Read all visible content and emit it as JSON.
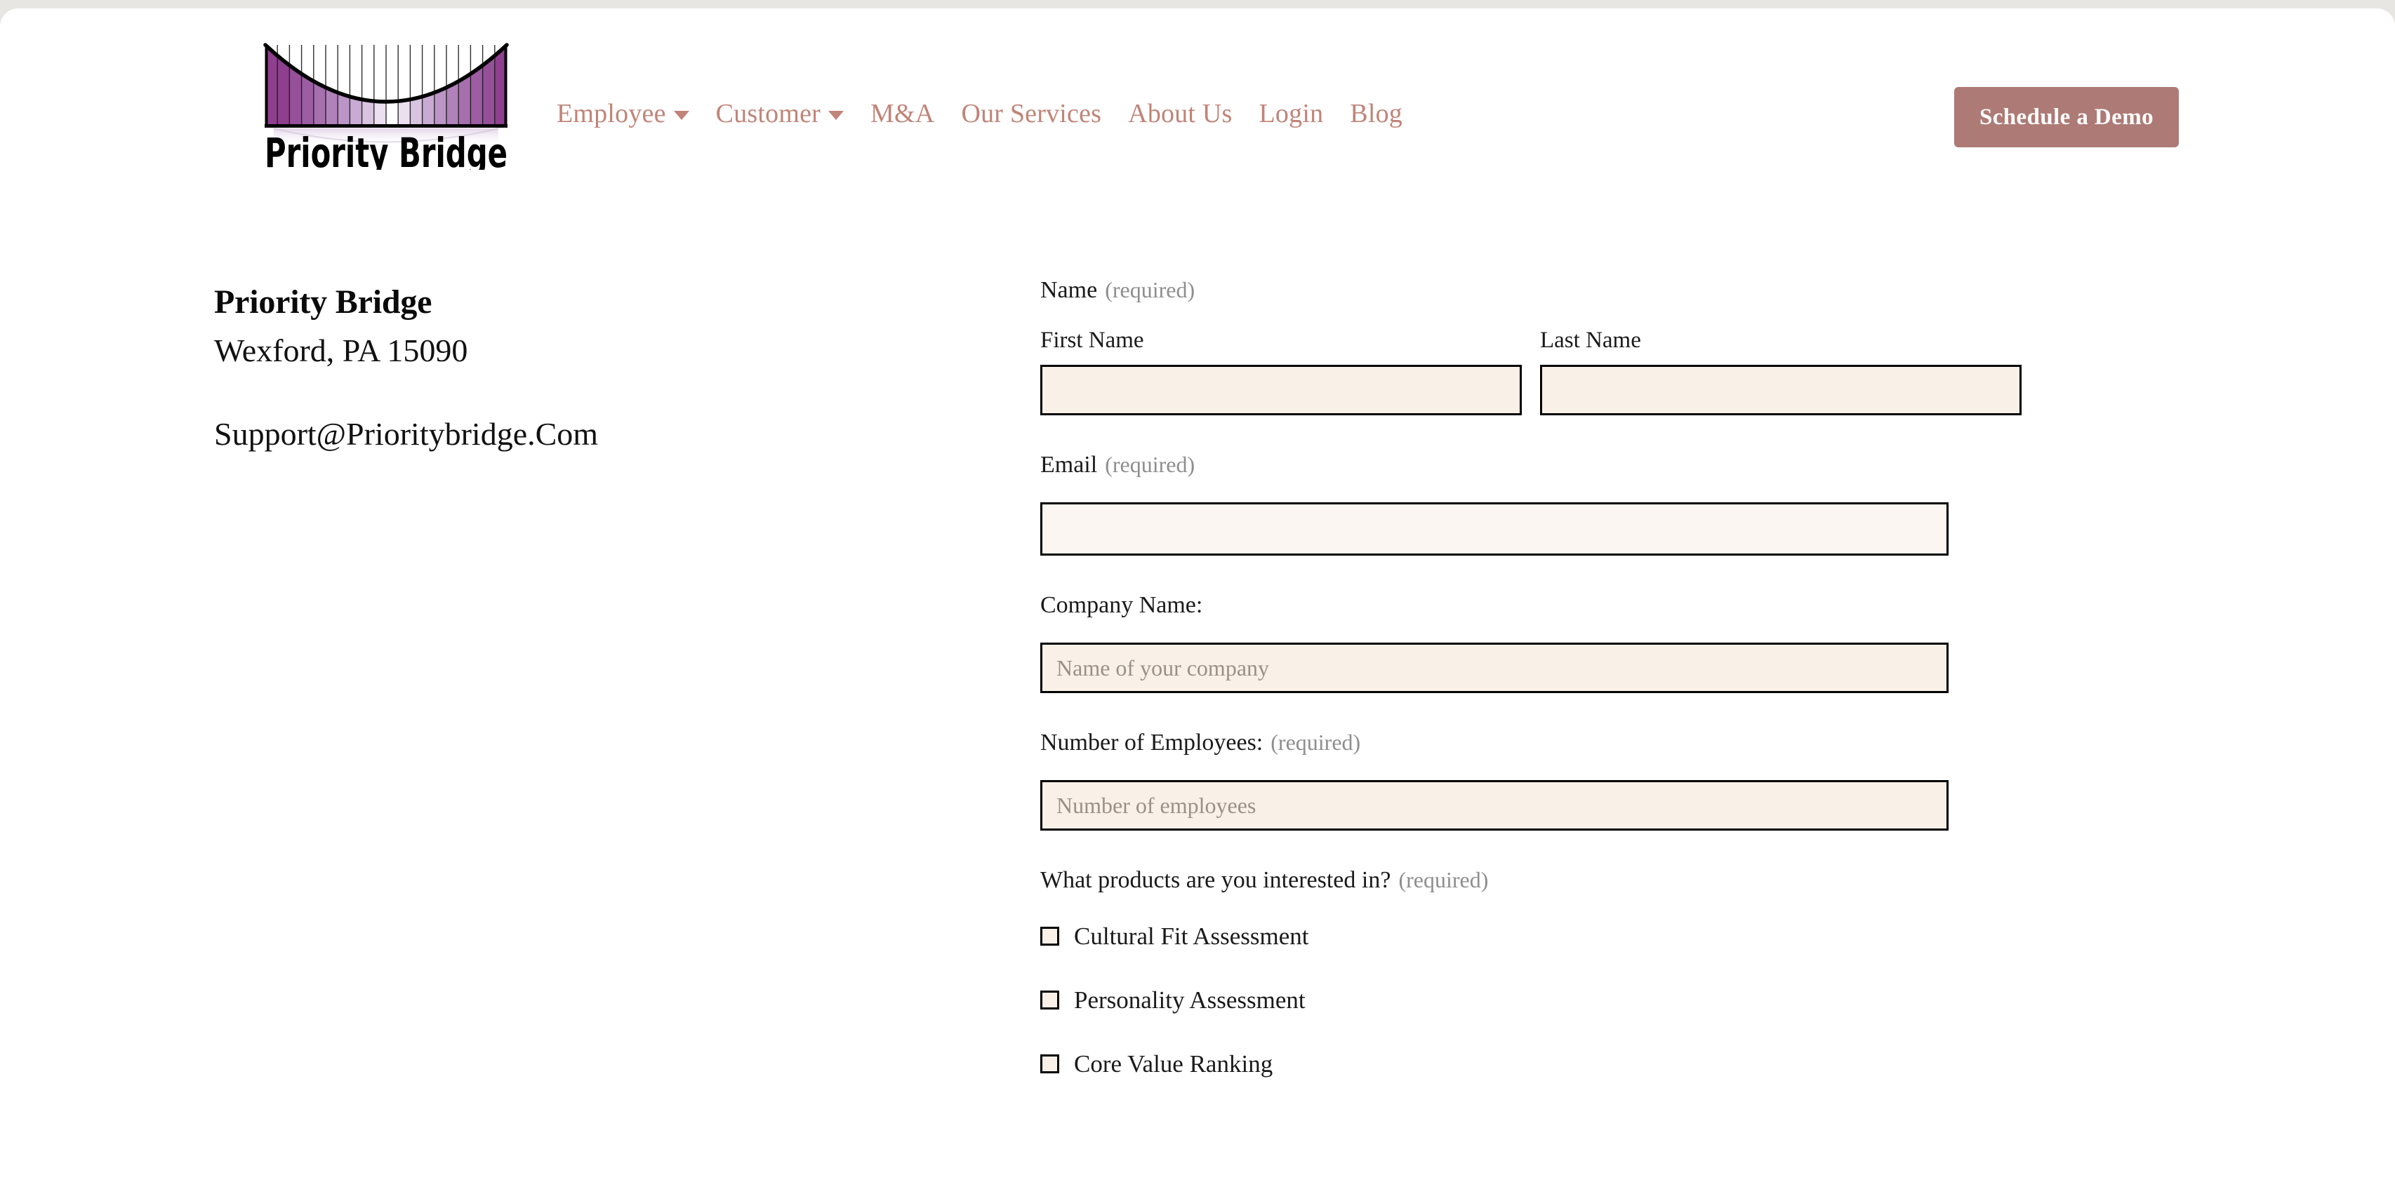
{
  "header": {
    "logo": {
      "icon": "bridge-logo-icon",
      "wordmark": "Priority Bridge",
      "bar_colors": [
        "#8e3f8e",
        "#8e3f8e",
        "#96509a",
        "#9c5da3",
        "#a66fae",
        "#b081bb",
        "#bb95c6",
        "#c8aad3",
        "#d8c3e0",
        "#ece0f0",
        "#ffffff",
        "#ece0f0",
        "#d8c3e0",
        "#c8aad3",
        "#bb95c6",
        "#b081bb",
        "#a66fae",
        "#9c5da3",
        "#96509a",
        "#8e3f8e",
        "#8e3f8e"
      ]
    },
    "nav": [
      {
        "label": "Employee",
        "has_dropdown": true,
        "caret_icon": "chevron-down-icon"
      },
      {
        "label": "Customer",
        "has_dropdown": true,
        "caret_icon": "chevron-down-icon"
      },
      {
        "label": "M&A",
        "has_dropdown": false
      },
      {
        "label": "Our Services",
        "has_dropdown": false
      },
      {
        "label": "About Us",
        "has_dropdown": false
      },
      {
        "label": "Login",
        "has_dropdown": false
      },
      {
        "label": "Blog",
        "has_dropdown": false
      }
    ],
    "cta_label": "Schedule a Demo",
    "nav_color": "#c08478",
    "cta_bg": "#ad7a75",
    "cta_text_color": "#ffffff"
  },
  "contact": {
    "company": "Priority Bridge",
    "address": "Wexford, PA 15090",
    "email": "Support@Prioritybridge.Com"
  },
  "form": {
    "name": {
      "label": "Name",
      "required_text": "(required)",
      "first": {
        "label": "First Name",
        "value": "",
        "placeholder": ""
      },
      "last": {
        "label": "Last Name",
        "value": "",
        "placeholder": ""
      }
    },
    "email": {
      "label": "Email",
      "required_text": "(required)",
      "value": "",
      "placeholder": ""
    },
    "company_name": {
      "label": "Company Name:",
      "value": "",
      "placeholder": "Name of your company"
    },
    "employees": {
      "label": "Number of Employees:",
      "required_text": "(required)",
      "value": "",
      "placeholder": "Number of employees"
    },
    "products": {
      "label": "What products are you interested in?",
      "required_text": "(required)",
      "options": [
        {
          "label": "Cultural Fit Assessment",
          "checked": false
        },
        {
          "label": "Personality Assessment",
          "checked": false
        },
        {
          "label": "Core Value Ranking",
          "checked": false
        }
      ]
    },
    "input_bg": "#f9f0e7",
    "input_border": "#000000",
    "placeholder_color": "#9a9087"
  }
}
